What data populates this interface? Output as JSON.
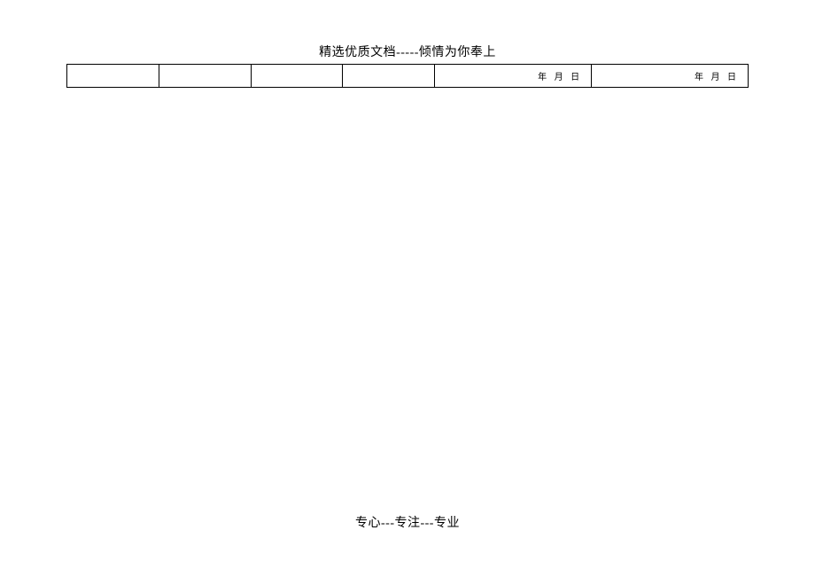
{
  "header": {
    "title": "精选优质文档-----倾情为你奉上"
  },
  "table": {
    "row": {
      "cell1": "",
      "cell2": "",
      "cell3": "",
      "cell4": "",
      "cell5": "年  月  日",
      "cell6": "年  月  日"
    }
  },
  "footer": {
    "text": "专心---专注---专业"
  }
}
